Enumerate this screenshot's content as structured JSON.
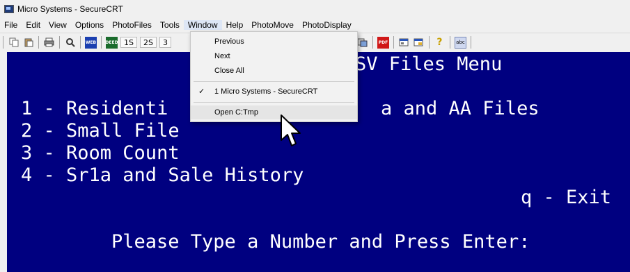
{
  "window": {
    "title": "Micro Systems - SecureCRT"
  },
  "menubar": {
    "items": [
      "File",
      "Edit",
      "View",
      "Options",
      "PhotoFiles",
      "Tools",
      "Window",
      "Help",
      "PhotoMove",
      "PhotoDisplay"
    ]
  },
  "toolbar": {
    "web_label": "WEB",
    "deed_label": "DEED",
    "btn_1s": "1S",
    "btn_2s": "2S",
    "btn_3": "3",
    "pdf_label": "PDF",
    "abc_label": "abc",
    "help_glyph": "?"
  },
  "terminal": {
    "header_line": "SV Files Menu",
    "option1": "1 - Residenti",
    "option1_tail": "a and AA Files",
    "option2": "2 - Small File",
    "option3": "3 - Room Count",
    "option4": "4 - Sr1a and Sale History",
    "exit": "q - Exit",
    "prompt": "Please Type a Number and Press Enter:",
    "bg_color": "#000080",
    "fg_color": "#ffffff"
  },
  "window_menu": {
    "previous": "Previous",
    "next": "Next",
    "close_all": "Close All",
    "session1": "1 Micro Systems - SecureCRT",
    "open_tmp": "Open C:Tmp",
    "check": "✓"
  }
}
